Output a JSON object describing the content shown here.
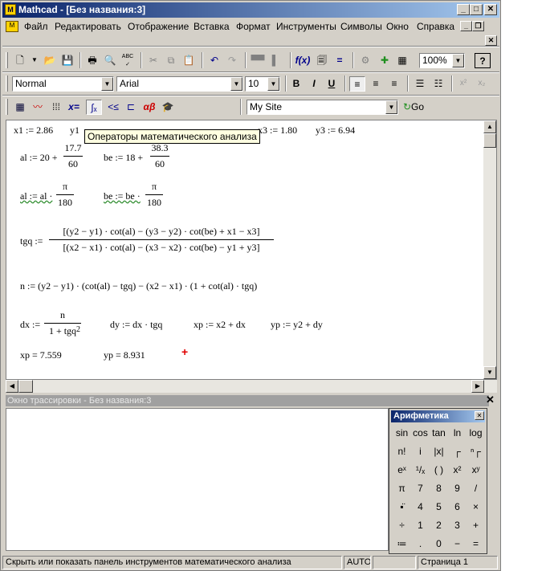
{
  "app": {
    "title": "Mathcad - [Без названия:3]"
  },
  "menu": [
    "Файл",
    "Редактировать",
    "Отображение",
    "Вставка",
    "Формат",
    "Инструменты",
    "Символы",
    "Окно",
    "Справка"
  ],
  "format": {
    "style": "Normal",
    "font": "Arial",
    "size": "10",
    "zoom": "100%",
    "site": "My Site",
    "go": "Go"
  },
  "tooltip": "Операторы математического анализа",
  "worksheet": {
    "row1": [
      "x1 := 2.86",
      "y1",
      "x3 := 1.80",
      "y3 := 6.94"
    ],
    "al_def": "al := 20 +",
    "al_num": "17.7",
    "al_den": "60",
    "be_def": "be := 18 +",
    "be_num": "38.3",
    "be_den": "60",
    "al_rad": "al := al ·",
    "pi": "π",
    "d180": "180",
    "be_rad": "be := be ·",
    "tgq_lhs": "tgq :=",
    "tgq_num": "[(y2 − y1) · cot(al) − (y3 − y2) · cot(be) + x1 − x3]",
    "tgq_den": "[(x2 − x1) · cot(al) − (x3 − x2) · cot(be) − y1 + y3]",
    "n_def": "n := (y2 − y1) · (cot(al) − tgq) − (x2 − x1) · (1 + cot(al) · tgq)",
    "dx_lhs": "dx :=",
    "dx_num": "n",
    "dx_den": "1 + tgq",
    "dx_exp": "2",
    "dy": "dy := dx · tgq",
    "xp": "xp := x2 + dx",
    "yp": "yp := y2 + dy",
    "xp_res": "xp = 7.559",
    "yp_res": "yp = 8.931"
  },
  "trace": {
    "title": "Окно трассировки - Без названия:3"
  },
  "palette": {
    "title": "Арифметика",
    "keys": [
      "sin",
      "cos",
      "tan",
      "ln",
      "log",
      "n!",
      "i",
      "|x|",
      "┌",
      "ⁿ┌",
      "eˣ",
      "¹/ₓ",
      "( )",
      "x²",
      "xʸ",
      "π",
      "7",
      "8",
      "9",
      "/",
      "▪̈",
      "4",
      "5",
      "6",
      "×",
      "÷",
      "1",
      "2",
      "3",
      "+",
      "≔",
      ".",
      "0",
      "−",
      "="
    ]
  },
  "status": {
    "hint": "Скрыть или показать панель инструментов математического анализа",
    "mode": "AUTO",
    "page": "Страница 1"
  }
}
